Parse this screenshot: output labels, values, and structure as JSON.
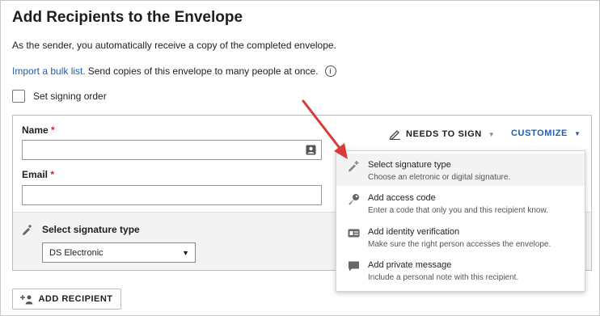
{
  "header": {
    "title": "Add Recipients to the Envelope",
    "subtitle": "As the sender, you automatically receive a copy of the completed envelope."
  },
  "bulk": {
    "link_label": "Import a bulk list.",
    "text": "Send copies of this envelope to many people at once.",
    "info_icon": "info-icon"
  },
  "signing_order": {
    "label": "Set signing order",
    "checked": false
  },
  "recipient": {
    "name_label": "Name",
    "email_label": "Email",
    "required_mark": "*",
    "name_value": "",
    "email_value": "",
    "action_label": "NEEDS TO SIGN",
    "customize_label": "CUSTOMIZE",
    "signature_type_label": "Select signature type",
    "signature_type_value": "DS Electronic"
  },
  "customize_menu": {
    "items": [
      {
        "title": "Select signature type",
        "desc": "Choose an eletronic or digital signature.",
        "icon": "pen-plus-icon"
      },
      {
        "title": "Add access code",
        "desc": "Enter a code that only you and this recipient know.",
        "icon": "key-icon"
      },
      {
        "title": "Add identity verification",
        "desc": "Make sure the right person accesses the envelope.",
        "icon": "id-card-icon"
      },
      {
        "title": "Add private message",
        "desc": "Include a personal note with this recipient.",
        "icon": "chat-bubble-icon"
      }
    ]
  },
  "footer": {
    "add_recipient_label": "ADD RECIPIENT"
  },
  "colors": {
    "link": "#1b5fb5",
    "required": "#c9252c",
    "annotation_arrow": "#d93a3a"
  }
}
